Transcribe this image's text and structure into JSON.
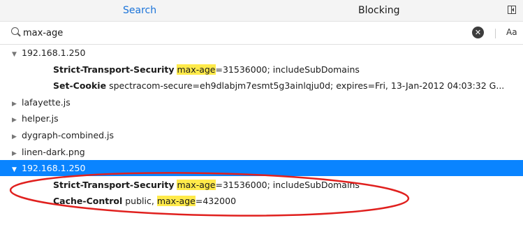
{
  "tabs": {
    "search_label": "Search",
    "blocking_label": "Blocking"
  },
  "search": {
    "value": "max-age",
    "placeholder": "",
    "case_toggle_label": "Aa"
  },
  "results": [
    {
      "type": "file",
      "expanded": true,
      "selected": false,
      "name": "192.168.1.250"
    },
    {
      "type": "match",
      "header": "Strict-Transport-Security",
      "before": "",
      "highlight": "max-age",
      "after": "=31536000; includeSubDomains"
    },
    {
      "type": "match",
      "header": "Set-Cookie",
      "before": "spectracom-secure=eh9dlabjm7esmt5g3ainlqju0d; expires=Fri, 13-Jan-2012 04:03:32 G...",
      "highlight": "",
      "after": ""
    },
    {
      "type": "file",
      "expanded": false,
      "selected": false,
      "name": "lafayette.js"
    },
    {
      "type": "file",
      "expanded": false,
      "selected": false,
      "name": "helper.js"
    },
    {
      "type": "file",
      "expanded": false,
      "selected": false,
      "name": "dygraph-combined.js"
    },
    {
      "type": "file",
      "expanded": false,
      "selected": false,
      "name": "linen-dark.png"
    },
    {
      "type": "file",
      "expanded": true,
      "selected": true,
      "name": "192.168.1.250"
    },
    {
      "type": "match",
      "header": "Strict-Transport-Security",
      "before": "",
      "highlight": "max-age",
      "after": "=31536000; includeSubDomains"
    },
    {
      "type": "match",
      "header": "Cache-Control",
      "before": "public, ",
      "highlight": "max-age",
      "after": "=432000"
    }
  ],
  "colors": {
    "accent": "#0a84ff",
    "highlight": "#ffea4a",
    "annotation": "#e0201e",
    "tab_active": "#1a73d9"
  }
}
